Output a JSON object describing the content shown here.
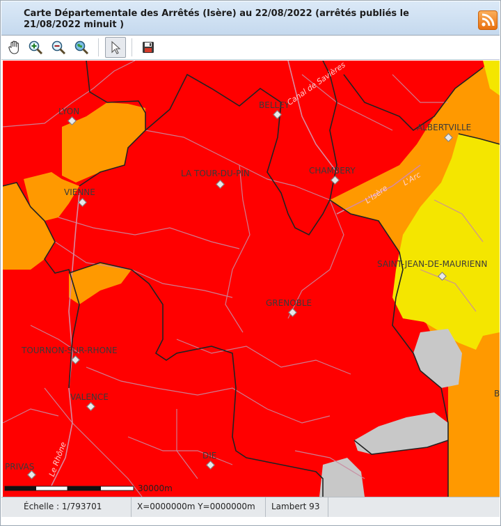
{
  "title": "Carte Départementale des Arrêtés (Isère) au 22/08/2022 (arrêtés publiés le 21/08/2022 minuit )",
  "icons": {
    "rss": "rss-feed-icon",
    "pan": "hand-pan-icon",
    "zoom_in": "zoom-in-icon",
    "zoom_out": "zoom-out-icon",
    "zoom_extent": "zoom-extent-globe-icon",
    "select": "pointer-select-icon",
    "save": "save-floppy-icon"
  },
  "toolbar": {
    "active_tool": "select"
  },
  "map": {
    "cities": [
      {
        "name": "LYON"
      },
      {
        "name": "BELLEY"
      },
      {
        "name": "ALBERTVILLE"
      },
      {
        "name": "LA TOUR-DU-PIN"
      },
      {
        "name": "CHAMBERY"
      },
      {
        "name": "VIENNE"
      },
      {
        "name": "SAINT-JEAN-DE-MAURIENN"
      },
      {
        "name": "GRENOBLE"
      },
      {
        "name": "TOURNON-SUR-RHONE"
      },
      {
        "name": "VALENCE"
      },
      {
        "name": "PRIVAS"
      },
      {
        "name": "DIE"
      },
      {
        "name": "B"
      }
    ],
    "water_labels": [
      "Canal de Savières",
      "L'Isère",
      "L'Arc",
      "Le Rhône"
    ],
    "scale_label": "30000m",
    "colors": {
      "red": "#ff0000",
      "orange": "#ff9900",
      "yellow": "#f4e600",
      "grey": "#c8c8c8",
      "border_dark": "#222222",
      "border_light": "#b08aa0"
    }
  },
  "statusbar": {
    "scale": "Échelle : 1/793701",
    "coords": "X=0000000m Y=0000000m",
    "projection": "Lambert 93"
  }
}
